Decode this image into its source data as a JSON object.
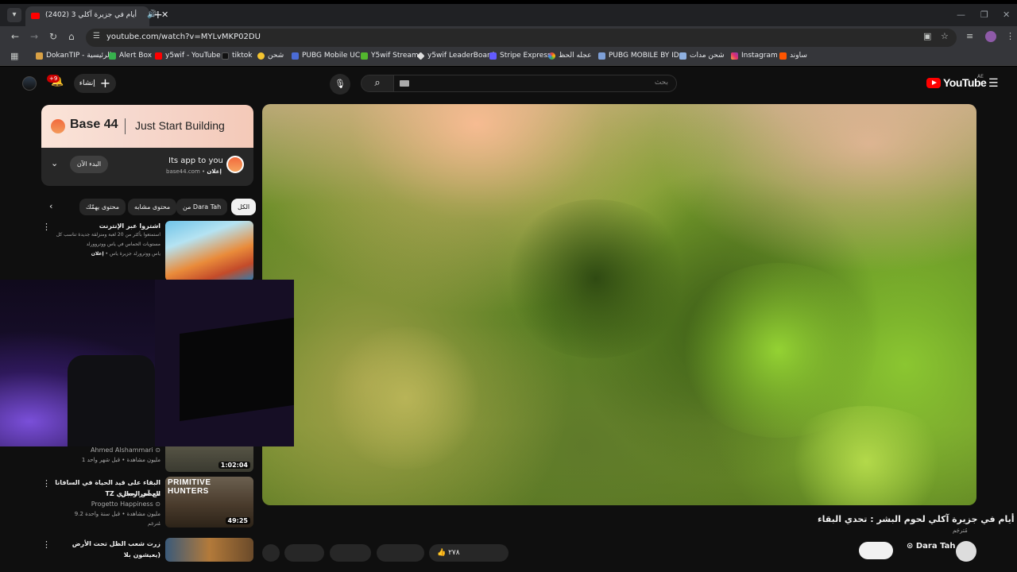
{
  "browser": {
    "tab": {
      "title": "(2402) 3 أيام في جزيرة آكلي"
    },
    "url": "youtube.com/watch?v=MYLvMKP02DU",
    "bookmarks": [
      "DokanTIP - الرئيسية",
      "Alert Box",
      "y5wif - YouTube",
      "tiktok",
      "شحن",
      "PUBG Mobile UC",
      "Y5wif Stream",
      "y5wif LeaderBoard",
      "Stripe Express",
      "عجله الحظ",
      "PUBG MOBILE BY ID...",
      "شحن مدات",
      "Instagram",
      "ساوند"
    ]
  },
  "youtube": {
    "logo": "YouTube",
    "region": "AE",
    "search_placeholder": "بحث",
    "create_label": "إنشاء",
    "notifications_badge": "+9"
  },
  "ad": {
    "brand": "Base 44",
    "tagline": "Just Start Building",
    "title": "Its app to you",
    "ad_label": "إعلان",
    "domain": "base44.com",
    "cta": "البدء الآن"
  },
  "chips": [
    "الكل",
    "من Dara Tah",
    "محتوى مشابه",
    "محتوى يهمّك"
  ],
  "sidebar": {
    "sponsored": {
      "title": "اشتروا عبر الإنترنت",
      "desc_line1": "استمتعوا بأكثر من 20 لعبة ومنزلقة جديدة تناسب كل",
      "desc_line2": "مستويات الحماس في ياس ووتروورلد",
      "ad_label": "إعلان",
      "advertiser": "ياس ووترورلد جزيرة ياس"
    },
    "videos": [
      {
        "channel": "Ahmed Alshammari",
        "meta": "1 مليون مشاهدة • قبل شهر واحد",
        "duration": "1:02:04"
      },
      {
        "title_line1": "البقاء على قيد الحياة في السافانا مع آخر رجال",
        "title_line2": "العصر الحجري TZ",
        "channel": "Progetto Happiness",
        "meta": "9.2 مليون مشاهدة • قبل سنة واحدة",
        "badge": "مُترجَم",
        "thumb_text": "PRIMITIVE HUNTERS",
        "duration": "49:25"
      },
      {
        "title_line1": "زرت شعب الظل تحت الأرض (يعيشون بلا"
      }
    ]
  },
  "video": {
    "title": "3 أيام في جزيرة آكلي لحوم البشر : تحدي البقاء",
    "subtitle": "مُترجَم",
    "channel": "Dara Tah",
    "likes_partial": "٢٧٨",
    "subscribe_label": ""
  }
}
